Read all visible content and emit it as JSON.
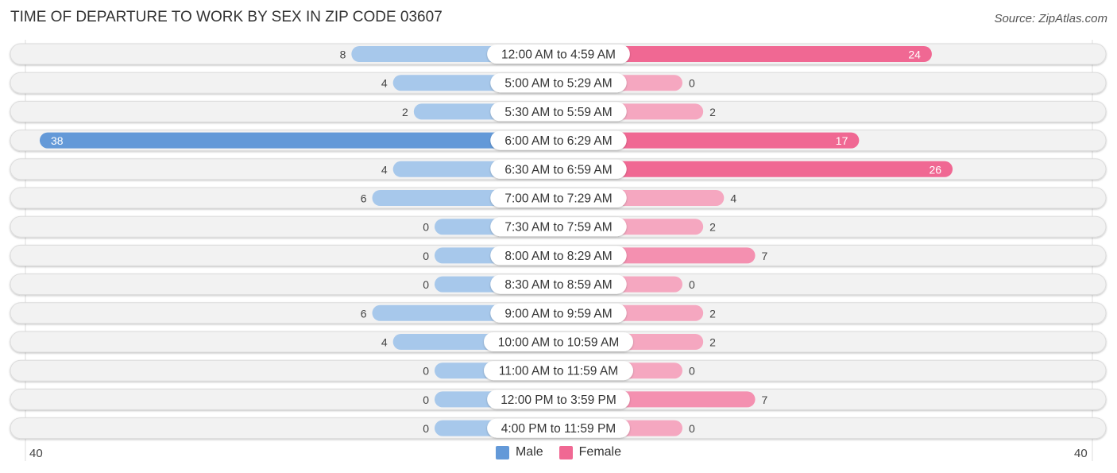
{
  "title": "TIME OF DEPARTURE TO WORK BY SEX IN ZIP CODE 03607",
  "source": "Source: ZipAtlas.com",
  "colors": {
    "male": "#a7c8eb",
    "male_strong": "#6399d8",
    "female": "#f5a7c0",
    "female_strong": "#f06893",
    "track": "#f2f2f2",
    "label_bg": "#ffffff"
  },
  "chart_data": {
    "type": "bar",
    "orientation": "horizontal-diverging",
    "title": "TIME OF DEPARTURE TO WORK BY SEX IN ZIP CODE 03607",
    "xlabel": "",
    "ylabel": "",
    "axis_min_label": "40",
    "axis_max_label": "40",
    "xlim": [
      -40,
      40
    ],
    "legend": [
      "Male",
      "Female"
    ],
    "legend_position": "bottom-center",
    "categories": [
      "12:00 AM to 4:59 AM",
      "5:00 AM to 5:29 AM",
      "5:30 AM to 5:59 AM",
      "6:00 AM to 6:29 AM",
      "6:30 AM to 6:59 AM",
      "7:00 AM to 7:29 AM",
      "7:30 AM to 7:59 AM",
      "8:00 AM to 8:29 AM",
      "8:30 AM to 8:59 AM",
      "9:00 AM to 9:59 AM",
      "10:00 AM to 10:59 AM",
      "11:00 AM to 11:59 AM",
      "12:00 PM to 3:59 PM",
      "4:00 PM to 11:59 PM"
    ],
    "series": [
      {
        "name": "Male",
        "values": [
          8,
          4,
          2,
          38,
          4,
          6,
          0,
          0,
          0,
          6,
          4,
          0,
          0,
          0
        ]
      },
      {
        "name": "Female",
        "values": [
          24,
          0,
          2,
          17,
          26,
          4,
          2,
          7,
          0,
          2,
          2,
          0,
          7,
          0
        ]
      }
    ]
  }
}
